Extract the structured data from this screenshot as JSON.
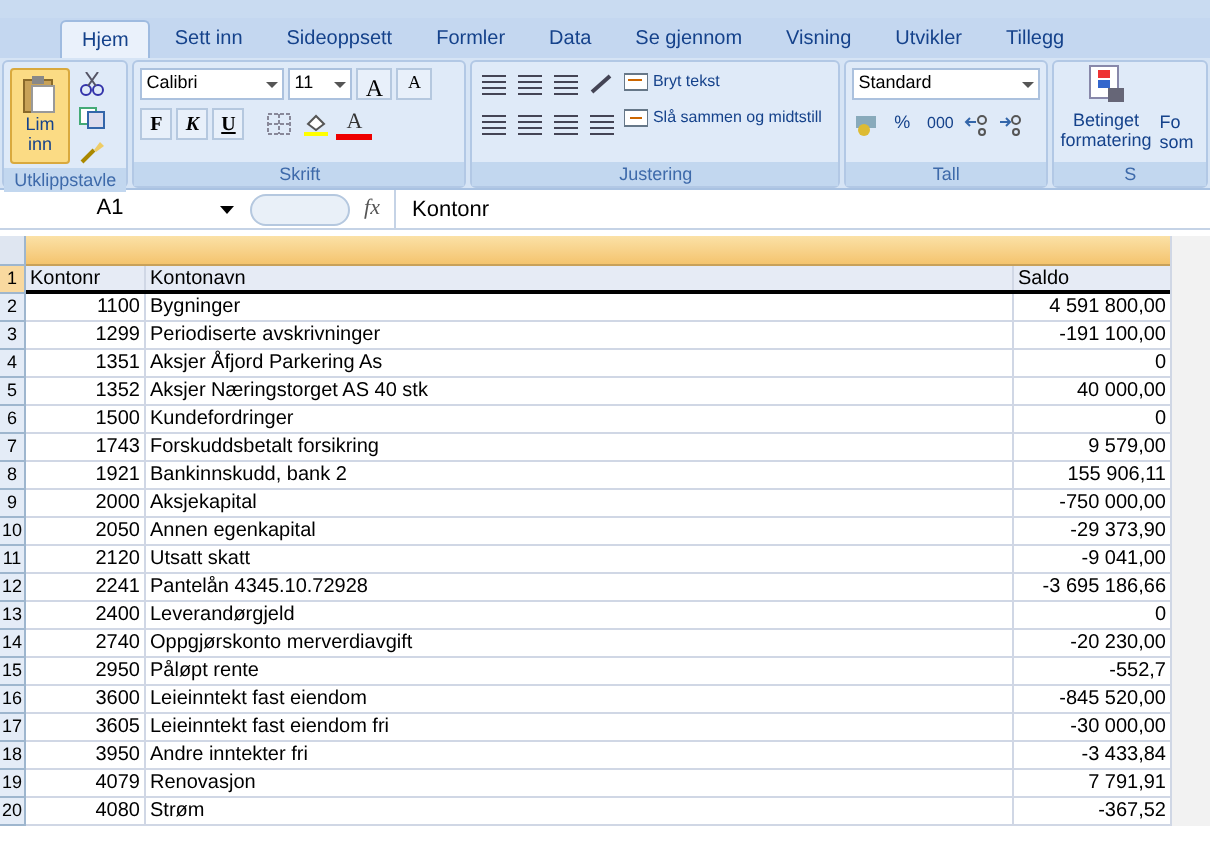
{
  "tabs": [
    {
      "label": "Hjem",
      "selected": true
    },
    {
      "label": "Sett inn",
      "selected": false
    },
    {
      "label": "Sideoppsett",
      "selected": false
    },
    {
      "label": "Formler",
      "selected": false
    },
    {
      "label": "Data",
      "selected": false
    },
    {
      "label": "Se gjennom",
      "selected": false
    },
    {
      "label": "Visning",
      "selected": false
    },
    {
      "label": "Utvikler",
      "selected": false
    },
    {
      "label": "Tillegg",
      "selected": false
    }
  ],
  "clipboard": {
    "paste": "Lim",
    "paste2": "inn",
    "label": "Utklippstavle"
  },
  "font": {
    "family": "Calibri",
    "size": "11",
    "grow": "A",
    "shrink": "A",
    "bold": "F",
    "italic": "K",
    "underline": "U",
    "color_letter": "A",
    "label": "Skrift"
  },
  "alignment": {
    "wrap": "Bryt tekst",
    "merge": "Slå sammen og midtstill",
    "label": "Justering"
  },
  "number": {
    "format": "Standard",
    "percent": "%",
    "thousands": "000",
    "label": "Tall"
  },
  "styles": {
    "conditional": "Betinget",
    "conditional2": "formatering",
    "format_table": "Fo",
    "format_table2": "som",
    "label": "S"
  },
  "formula_bar": {
    "name_box": "A1",
    "fx": "fx",
    "value": "Kontonr"
  },
  "rows": [
    {
      "num": "1",
      "cells": [
        "Kontonr",
        "Kontonavn",
        "Saldo"
      ],
      "selected": true
    },
    {
      "num": "2",
      "cells": [
        "1100",
        "Bygninger",
        "4 591 800,00"
      ],
      "selected": false
    },
    {
      "num": "3",
      "cells": [
        "1299",
        "Periodiserte avskrivninger",
        "-191 100,00"
      ],
      "selected": false
    },
    {
      "num": "4",
      "cells": [
        "1351",
        "Aksjer Åfjord Parkering As",
        "0"
      ],
      "selected": false
    },
    {
      "num": "5",
      "cells": [
        "1352",
        "Aksjer Næringstorget AS 40 stk",
        "40 000,00"
      ],
      "selected": false
    },
    {
      "num": "6",
      "cells": [
        "1500",
        "Kundefordringer",
        "0"
      ],
      "selected": false
    },
    {
      "num": "7",
      "cells": [
        "1743",
        "Forskuddsbetalt forsikring",
        "9 579,00"
      ],
      "selected": false
    },
    {
      "num": "8",
      "cells": [
        "1921",
        "Bankinnskudd, bank 2",
        "155 906,11"
      ],
      "selected": false
    },
    {
      "num": "9",
      "cells": [
        "2000",
        "Aksjekapital",
        "-750 000,00"
      ],
      "selected": false
    },
    {
      "num": "10",
      "cells": [
        "2050",
        "Annen egenkapital",
        "-29 373,90"
      ],
      "selected": false
    },
    {
      "num": "11",
      "cells": [
        "2120",
        "Utsatt skatt",
        "-9 041,00"
      ],
      "selected": false
    },
    {
      "num": "12",
      "cells": [
        "2241",
        "Pantelån 4345.10.72928",
        "-3 695 186,66"
      ],
      "selected": false
    },
    {
      "num": "13",
      "cells": [
        "2400",
        "Leverandørgjeld",
        "0"
      ],
      "selected": false
    },
    {
      "num": "14",
      "cells": [
        "2740",
        "Oppgjørskonto merverdiavgift",
        "-20 230,00"
      ],
      "selected": false
    },
    {
      "num": "15",
      "cells": [
        "2950",
        "Påløpt rente",
        "-552,7"
      ],
      "selected": false
    },
    {
      "num": "16",
      "cells": [
        "3600",
        "Leieinntekt fast eiendom",
        "-845 520,00"
      ],
      "selected": false
    },
    {
      "num": "17",
      "cells": [
        "3605",
        "Leieinntekt fast eiendom fri",
        "-30 000,00"
      ],
      "selected": false
    },
    {
      "num": "18",
      "cells": [
        "3950",
        "Andre inntekter fri",
        "-3 433,84"
      ],
      "selected": false
    },
    {
      "num": "19",
      "cells": [
        "4079",
        "Renovasjon",
        "7 791,91"
      ],
      "selected": false
    },
    {
      "num": "20",
      "cells": [
        "4080",
        "Strøm",
        "-367,52"
      ],
      "selected": false
    }
  ]
}
